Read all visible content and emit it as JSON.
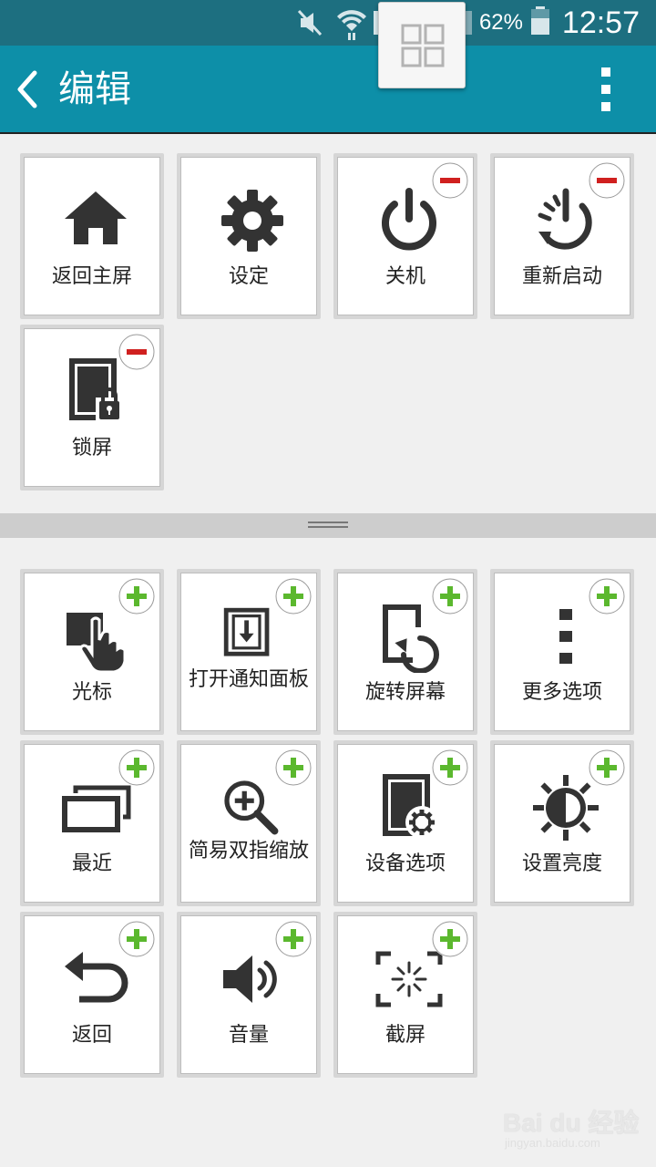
{
  "status_bar": {
    "battery_text": "62%",
    "time": "12:57"
  },
  "action_bar": {
    "title": "编辑"
  },
  "active_tiles": [
    {
      "label": "返回主屏",
      "icon": "home-icon",
      "badge": "none"
    },
    {
      "label": "设定",
      "icon": "gear-icon",
      "badge": "remove"
    },
    {
      "label": "关机",
      "icon": "power-icon",
      "badge": "remove"
    },
    {
      "label": "重新启动",
      "icon": "restart-icon",
      "badge": "remove"
    },
    {
      "label": "锁屏",
      "icon": "lock-screen-icon",
      "badge": "remove"
    }
  ],
  "available_tiles": [
    {
      "label": "光标",
      "icon": "cursor-hand-icon",
      "badge": "add"
    },
    {
      "label": "打开通知面板",
      "icon": "notification-panel-icon",
      "badge": "add"
    },
    {
      "label": "旋转屏幕",
      "icon": "rotate-screen-icon",
      "badge": "add"
    },
    {
      "label": "更多选项",
      "icon": "more-options-icon",
      "badge": "add"
    },
    {
      "label": "最近",
      "icon": "recent-apps-icon",
      "badge": "add"
    },
    {
      "label": "简易双指缩放",
      "icon": "zoom-in-icon",
      "badge": "add"
    },
    {
      "label": "设备选项",
      "icon": "device-options-icon",
      "badge": "add"
    },
    {
      "label": "设置亮度",
      "icon": "brightness-icon",
      "badge": "add"
    },
    {
      "label": "返回",
      "icon": "back-arrow-icon",
      "badge": "add"
    },
    {
      "label": "音量",
      "icon": "volume-icon",
      "badge": "add"
    },
    {
      "label": "截屏",
      "icon": "screenshot-icon",
      "badge": "add"
    }
  ],
  "watermark": {
    "main": "Bai du 经验",
    "sub": "jingyan.baidu.com"
  },
  "colors": {
    "status_bar": "#1d6f80",
    "action_bar": "#0d8fa8",
    "add_badge": "#5bb82e",
    "remove_badge": "#d0201f",
    "icon": "#333333"
  }
}
